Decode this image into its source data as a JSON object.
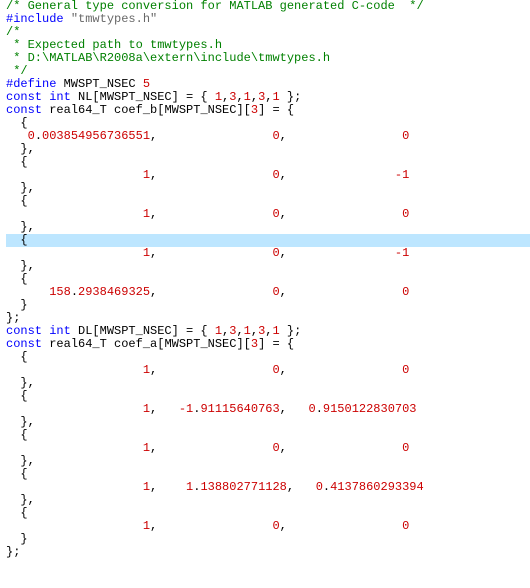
{
  "lines": [
    {
      "segs": [
        {
          "t": "/* General type conversion for MATLAB generated C-code  */",
          "cls": "c"
        }
      ]
    },
    {
      "segs": [
        {
          "t": "#include ",
          "cls": "pp"
        },
        {
          "t": "\"tmwtypes.h\"",
          "cls": "str"
        }
      ]
    },
    {
      "segs": [
        {
          "t": "/*",
          "cls": "c"
        }
      ]
    },
    {
      "segs": [
        {
          "t": " * Expected path to tmwtypes.h",
          "cls": "c"
        }
      ]
    },
    {
      "segs": [
        {
          "t": " * D:\\MATLAB\\R2008a\\extern\\include\\tmwtypes.h",
          "cls": "c"
        }
      ]
    },
    {
      "segs": [
        {
          "t": " */",
          "cls": "c"
        }
      ]
    },
    {
      "segs": [
        {
          "t": "#define ",
          "cls": "pp"
        },
        {
          "t": "MWSPT_NSEC ",
          "cls": "p"
        },
        {
          "t": "5",
          "cls": "num"
        }
      ]
    },
    {
      "segs": [
        {
          "t": "const int ",
          "cls": "kw"
        },
        {
          "t": "NL[MWSPT_NSEC] = { ",
          "cls": "p"
        },
        {
          "t": "1",
          "cls": "num"
        },
        {
          "t": ",",
          "cls": "p"
        },
        {
          "t": "3",
          "cls": "num"
        },
        {
          "t": ",",
          "cls": "p"
        },
        {
          "t": "1",
          "cls": "num"
        },
        {
          "t": ",",
          "cls": "p"
        },
        {
          "t": "3",
          "cls": "num"
        },
        {
          "t": ",",
          "cls": "p"
        },
        {
          "t": "1",
          "cls": "num"
        },
        {
          "t": " };",
          "cls": "p"
        }
      ]
    },
    {
      "segs": [
        {
          "t": "const ",
          "cls": "kw"
        },
        {
          "t": "real64_T coef_b[MWSPT_NSEC][",
          "cls": "p"
        },
        {
          "t": "3",
          "cls": "num"
        },
        {
          "t": "] = {",
          "cls": "p"
        }
      ]
    },
    {
      "segs": [
        {
          "t": "  {",
          "cls": "p"
        }
      ]
    },
    {
      "segs": [
        {
          "t": "   ",
          "cls": "p"
        },
        {
          "t": "0",
          "cls": "num"
        },
        {
          "t": ".",
          "cls": "p"
        },
        {
          "t": "003854956736551",
          "cls": "num"
        },
        {
          "t": ",                ",
          "cls": "p"
        },
        {
          "t": "0",
          "cls": "num"
        },
        {
          "t": ",                ",
          "cls": "p"
        },
        {
          "t": "0",
          "cls": "num"
        }
      ]
    },
    {
      "segs": [
        {
          "t": "  },",
          "cls": "p"
        }
      ]
    },
    {
      "segs": [
        {
          "t": "  {",
          "cls": "p"
        }
      ]
    },
    {
      "segs": [
        {
          "t": "                   ",
          "cls": "p"
        },
        {
          "t": "1",
          "cls": "num"
        },
        {
          "t": ",                ",
          "cls": "p"
        },
        {
          "t": "0",
          "cls": "num"
        },
        {
          "t": ",               ",
          "cls": "p"
        },
        {
          "t": "-1",
          "cls": "num"
        }
      ]
    },
    {
      "segs": [
        {
          "t": "  },",
          "cls": "p"
        }
      ]
    },
    {
      "segs": [
        {
          "t": "  {",
          "cls": "p"
        }
      ]
    },
    {
      "segs": [
        {
          "t": "                   ",
          "cls": "p"
        },
        {
          "t": "1",
          "cls": "num"
        },
        {
          "t": ",                ",
          "cls": "p"
        },
        {
          "t": "0",
          "cls": "num"
        },
        {
          "t": ",                ",
          "cls": "p"
        },
        {
          "t": "0",
          "cls": "num"
        }
      ]
    },
    {
      "segs": [
        {
          "t": "  },",
          "cls": "p"
        }
      ]
    },
    {
      "segs": [
        {
          "t": "  {",
          "cls": "p"
        }
      ],
      "hl": true
    },
    {
      "segs": [
        {
          "t": "                   ",
          "cls": "p"
        },
        {
          "t": "1",
          "cls": "num"
        },
        {
          "t": ",                ",
          "cls": "p"
        },
        {
          "t": "0",
          "cls": "num"
        },
        {
          "t": ",               ",
          "cls": "p"
        },
        {
          "t": "-1",
          "cls": "num"
        }
      ]
    },
    {
      "segs": [
        {
          "t": "  },",
          "cls": "p"
        }
      ]
    },
    {
      "segs": [
        {
          "t": "  {",
          "cls": "p"
        }
      ]
    },
    {
      "segs": [
        {
          "t": "      ",
          "cls": "p"
        },
        {
          "t": "158",
          "cls": "num"
        },
        {
          "t": ".",
          "cls": "p"
        },
        {
          "t": "2938469325",
          "cls": "num"
        },
        {
          "t": ",                ",
          "cls": "p"
        },
        {
          "t": "0",
          "cls": "num"
        },
        {
          "t": ",                ",
          "cls": "p"
        },
        {
          "t": "0",
          "cls": "num"
        }
      ]
    },
    {
      "segs": [
        {
          "t": "  }",
          "cls": "p"
        }
      ]
    },
    {
      "segs": [
        {
          "t": "};",
          "cls": "p"
        }
      ]
    },
    {
      "segs": [
        {
          "t": "const int ",
          "cls": "kw"
        },
        {
          "t": "DL[MWSPT_NSEC] = { ",
          "cls": "p"
        },
        {
          "t": "1",
          "cls": "num"
        },
        {
          "t": ",",
          "cls": "p"
        },
        {
          "t": "3",
          "cls": "num"
        },
        {
          "t": ",",
          "cls": "p"
        },
        {
          "t": "1",
          "cls": "num"
        },
        {
          "t": ",",
          "cls": "p"
        },
        {
          "t": "3",
          "cls": "num"
        },
        {
          "t": ",",
          "cls": "p"
        },
        {
          "t": "1",
          "cls": "num"
        },
        {
          "t": " };",
          "cls": "p"
        }
      ]
    },
    {
      "segs": [
        {
          "t": "const ",
          "cls": "kw"
        },
        {
          "t": "real64_T coef_a[MWSPT_NSEC][",
          "cls": "p"
        },
        {
          "t": "3",
          "cls": "num"
        },
        {
          "t": "] = {",
          "cls": "p"
        }
      ]
    },
    {
      "segs": [
        {
          "t": "  {",
          "cls": "p"
        }
      ]
    },
    {
      "segs": [
        {
          "t": "                   ",
          "cls": "p"
        },
        {
          "t": "1",
          "cls": "num"
        },
        {
          "t": ",                ",
          "cls": "p"
        },
        {
          "t": "0",
          "cls": "num"
        },
        {
          "t": ",                ",
          "cls": "p"
        },
        {
          "t": "0",
          "cls": "num"
        }
      ]
    },
    {
      "segs": [
        {
          "t": "  },",
          "cls": "p"
        }
      ]
    },
    {
      "segs": [
        {
          "t": "  {",
          "cls": "p"
        }
      ]
    },
    {
      "segs": [
        {
          "t": "                   ",
          "cls": "p"
        },
        {
          "t": "1",
          "cls": "num"
        },
        {
          "t": ",   ",
          "cls": "p"
        },
        {
          "t": "-1",
          "cls": "num"
        },
        {
          "t": ".",
          "cls": "p"
        },
        {
          "t": "91115640763",
          "cls": "num"
        },
        {
          "t": ",   ",
          "cls": "p"
        },
        {
          "t": "0",
          "cls": "num"
        },
        {
          "t": ".",
          "cls": "p"
        },
        {
          "t": "9150122830703",
          "cls": "num"
        }
      ]
    },
    {
      "segs": [
        {
          "t": "  },",
          "cls": "p"
        }
      ]
    },
    {
      "segs": [
        {
          "t": "  {",
          "cls": "p"
        }
      ]
    },
    {
      "segs": [
        {
          "t": "                   ",
          "cls": "p"
        },
        {
          "t": "1",
          "cls": "num"
        },
        {
          "t": ",                ",
          "cls": "p"
        },
        {
          "t": "0",
          "cls": "num"
        },
        {
          "t": ",                ",
          "cls": "p"
        },
        {
          "t": "0",
          "cls": "num"
        }
      ]
    },
    {
      "segs": [
        {
          "t": "  },",
          "cls": "p"
        }
      ]
    },
    {
      "segs": [
        {
          "t": "  {",
          "cls": "p"
        }
      ]
    },
    {
      "segs": [
        {
          "t": "                   ",
          "cls": "p"
        },
        {
          "t": "1",
          "cls": "num"
        },
        {
          "t": ",    ",
          "cls": "p"
        },
        {
          "t": "1",
          "cls": "num"
        },
        {
          "t": ".",
          "cls": "p"
        },
        {
          "t": "138802771128",
          "cls": "num"
        },
        {
          "t": ",   ",
          "cls": "p"
        },
        {
          "t": "0",
          "cls": "num"
        },
        {
          "t": ".",
          "cls": "p"
        },
        {
          "t": "4137860293394",
          "cls": "num"
        }
      ]
    },
    {
      "segs": [
        {
          "t": "  },",
          "cls": "p"
        }
      ]
    },
    {
      "segs": [
        {
          "t": "  {",
          "cls": "p"
        }
      ]
    },
    {
      "segs": [
        {
          "t": "                   ",
          "cls": "p"
        },
        {
          "t": "1",
          "cls": "num"
        },
        {
          "t": ",                ",
          "cls": "p"
        },
        {
          "t": "0",
          "cls": "num"
        },
        {
          "t": ",                ",
          "cls": "p"
        },
        {
          "t": "0",
          "cls": "num"
        }
      ]
    },
    {
      "segs": [
        {
          "t": "  }",
          "cls": "p"
        }
      ]
    },
    {
      "segs": [
        {
          "t": "};",
          "cls": "p"
        }
      ]
    }
  ]
}
